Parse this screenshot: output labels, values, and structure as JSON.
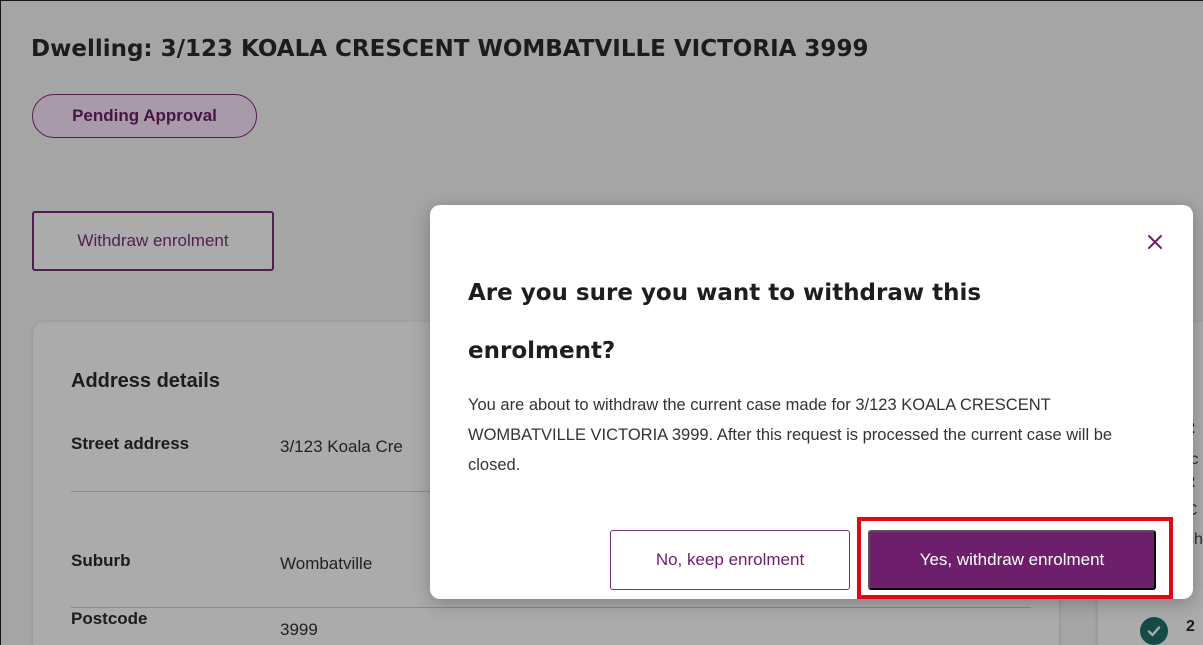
{
  "page": {
    "title": "Dwelling: 3/123 KOALA CRESCENT WOMBATVILLE VICTORIA 3999",
    "status_badge": "Pending Approval",
    "withdraw_button": "Withdraw enrolment"
  },
  "address_card": {
    "heading": "Address details",
    "rows": [
      {
        "label": "Street address",
        "value": "3/123 Koala Cre"
      },
      {
        "label": "Suburb",
        "value": "Wombatville"
      },
      {
        "label": "Postcode",
        "value": "3999"
      }
    ]
  },
  "right_panel": {
    "fragments": [
      "i",
      "2",
      "/c",
      "2",
      "C",
      "ch",
      "2"
    ]
  },
  "modal": {
    "title": "Are you sure you want to withdraw this enrolment?",
    "body": "You are about to withdraw the current case made for 3/123 KOALA CRESCENT WOMBATVILLE VICTORIA 3999. After this request is processed the current case will be closed.",
    "close_icon": "close-icon",
    "cancel_button": "No, keep enrolment",
    "confirm_button": "Yes, withdraw enrolment"
  },
  "colors": {
    "brand_purple": "#6d1f6b",
    "badge_bg": "#fbe6fb",
    "highlight_red": "#e30613",
    "check_teal": "#1e6f6a"
  }
}
